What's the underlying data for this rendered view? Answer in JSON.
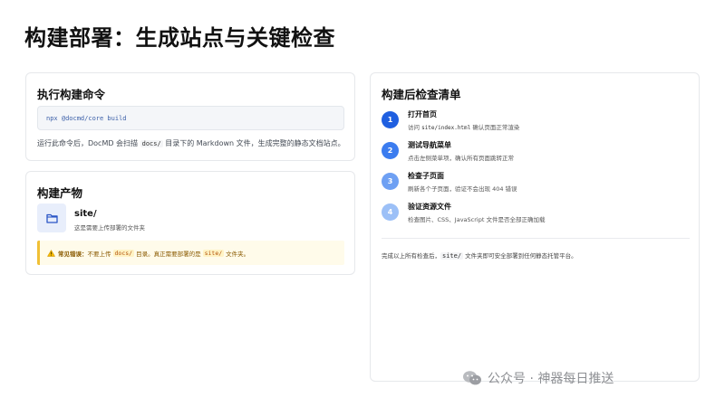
{
  "page": {
    "title": "构建部署：生成站点与关键检查"
  },
  "build_command": {
    "heading": "执行构建命令",
    "command": "npx @docmd/core build",
    "desc_before": "运行此命令后，DocMD 会扫描 ",
    "desc_code": "docs/",
    "desc_after": " 目录下的 Markdown 文件，生成完整的静态文档站点。"
  },
  "build_output": {
    "heading": "构建产物",
    "folder_icon": "folder-icon",
    "folder_name": "site/",
    "folder_desc": "这是需要上传部署的文件夹",
    "warning": {
      "icon": "warning-icon",
      "label": "常见错误：",
      "text1": "不要上传 ",
      "code1": "docs/",
      "text2": " 目录。真正需要部署的是 ",
      "code2": "site/",
      "text3": " 文件夹。"
    }
  },
  "checklist": {
    "heading": "构建后检查清单",
    "items": [
      {
        "num": "1",
        "title": "打开首页",
        "desc_before": "访问 ",
        "desc_code": "site/index.html",
        "desc_after": " 确认页面正常渲染",
        "color": "#1f5fe0"
      },
      {
        "num": "2",
        "title": "测试导航菜单",
        "desc_before": "点击左侧菜单项，确认所有页面跳转正常",
        "desc_code": "",
        "desc_after": "",
        "color": "#3b7cef"
      },
      {
        "num": "3",
        "title": "检查子页面",
        "desc_before": "刷新各个子页面，验证不会出现 404 错误",
        "desc_code": "",
        "desc_after": "",
        "color": "#6ea0f3"
      },
      {
        "num": "4",
        "title": "验证资源文件",
        "desc_before": "检查图片、CSS、JavaScript 文件是否全部正确加载",
        "desc_code": "",
        "desc_after": "",
        "color": "#9cc0f7"
      }
    ],
    "footer_before": "完成以上所有检查后，",
    "footer_code": "site/",
    "footer_after": " 文件夹即可安全部署到任何静态托管平台。"
  },
  "watermark": {
    "logo": "wechat-icon",
    "text": "公众号 · 神器每日推送"
  },
  "colors": {
    "accent": "#1f5fe0",
    "warning_border": "#f0c036",
    "warning_bg": "#fffbea"
  }
}
